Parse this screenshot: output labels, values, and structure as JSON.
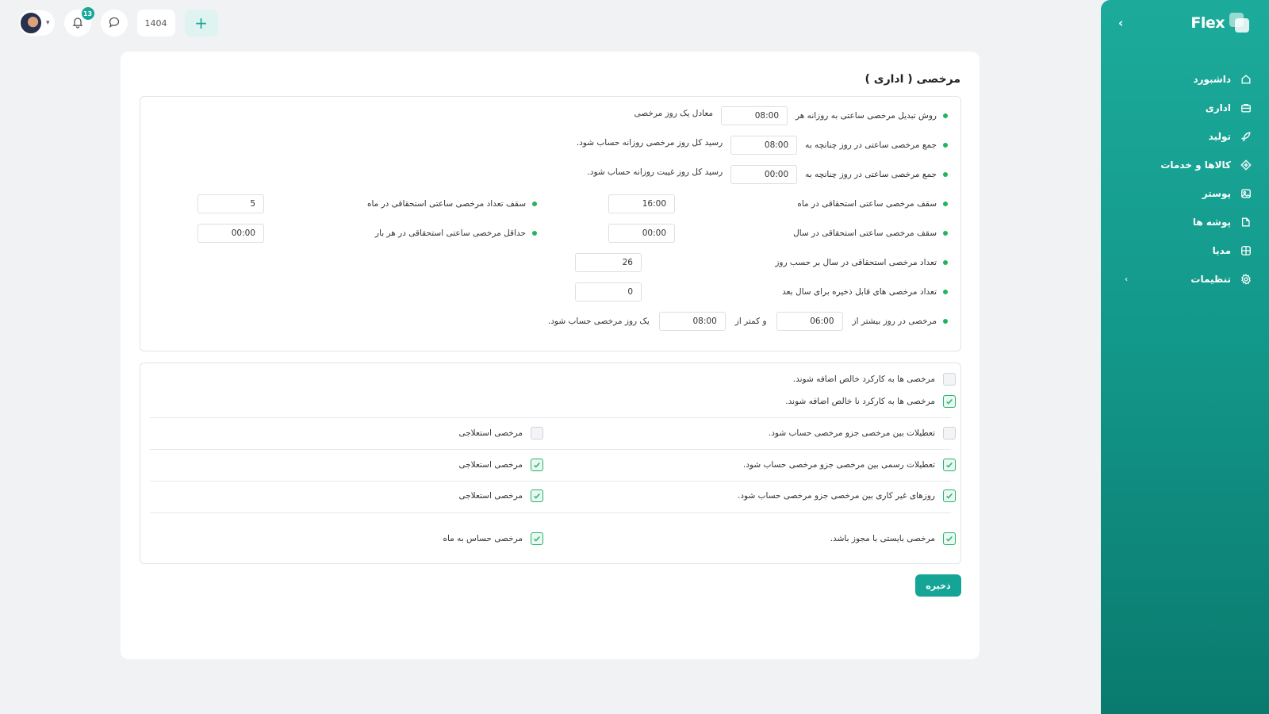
{
  "app": {
    "logo_text": "Flex"
  },
  "sidebar": {
    "items": [
      {
        "label": "داشبورد",
        "icon": "home-icon"
      },
      {
        "label": "اداری",
        "icon": "briefcase-icon"
      },
      {
        "label": "تولید",
        "icon": "rocket-icon"
      },
      {
        "label": "کالاها و خدمات",
        "icon": "diamond-icon"
      },
      {
        "label": "پوستر",
        "icon": "image-icon"
      },
      {
        "label": "پوشه ها",
        "icon": "folder-icon"
      },
      {
        "label": "مدیا",
        "icon": "globe-icon"
      },
      {
        "label": "تنظیمات",
        "icon": "gear-icon",
        "has_submenu": true
      }
    ]
  },
  "topbar": {
    "notification_count": "13",
    "year": "1404",
    "add_symbol": "+"
  },
  "page": {
    "title": "مرخصی ( اداری )"
  },
  "settings": {
    "r1_label": "روش تبدیل مرخصی ساعتی به روزانه هر",
    "r1_value": "08:00",
    "r1_suffix": "معادل یک روز مرخصی",
    "r2_label": "جمع مرخصی ساعتی در روز چنانچه به",
    "r2_value": "08:00",
    "r2_suffix": "رسید کل روز مرخصی روزانه حساب شود.",
    "r3_label": "جمع مرخصی ساعتی در روز چنانچه به",
    "r3_value": "00:00",
    "r3_suffix": "رسید کل روز غیبت روزانه حساب شود.",
    "r4_label": "سقف مرخصی ساعتی استحقاقی در ماه",
    "r4_value": "16:00",
    "r4b_label": "سقف تعداد مرخصی ساعتی استحقاقی در ماه",
    "r4b_value": "5",
    "r5_label": "سقف مرخصی ساعتی استحقاقی در سال",
    "r5_value": "00:00",
    "r5b_label": "حداقل مرخصی ساعتی استحقاقی در هر بار",
    "r5b_value": "00:00",
    "r6_label": "تعداد مرخصی استحقاقی در سال بر حسب روز",
    "r6_value": "26",
    "r7_label": "تعداد مرخصی های قابل ذخیره برای سال بعد",
    "r7_value": "0",
    "r8_label": "مرخصی در روز بیشتر از",
    "r8_value1": "06:00",
    "r8_mid": "و کمتر از",
    "r8_value2": "08:00",
    "r8_suffix": "یک روز مرخصی حساب شود."
  },
  "options": {
    "o1": {
      "label": "مرخصی ها به کارکرد خالص اضافه شوند.",
      "checked": false
    },
    "o2": {
      "label": "مرخصی ها به کارکرد نا خالص اضافه شوند.",
      "checked": true
    },
    "o3": {
      "label": "تعطیلات بین مرخصی جزو مرخصی حساب شود.",
      "checked": false
    },
    "o3b": {
      "label": "مرخصی استعلاجی",
      "checked": false
    },
    "o4": {
      "label": "تعطیلات رسمی بین مرخصی جزو مرخصی حساب شود.",
      "checked": true
    },
    "o4b": {
      "label": "مرخصی استعلاجی",
      "checked": true
    },
    "o5": {
      "label": "روزهای غیر کاری بین مرخصی جزو مرخصی حساب شود.",
      "checked": true
    },
    "o5b": {
      "label": "مرخصی استعلاجی",
      "checked": true
    },
    "o6": {
      "label": "مرخصی بایستی با مجوز باشد.",
      "checked": true
    },
    "o6b": {
      "label": "مرخصی حساس به ماه",
      "checked": true
    }
  },
  "actions": {
    "save_label": "ذخیره"
  },
  "colors": {
    "accent": "#14a596",
    "status_dot": "#22b45a",
    "check": "#27b36a"
  }
}
